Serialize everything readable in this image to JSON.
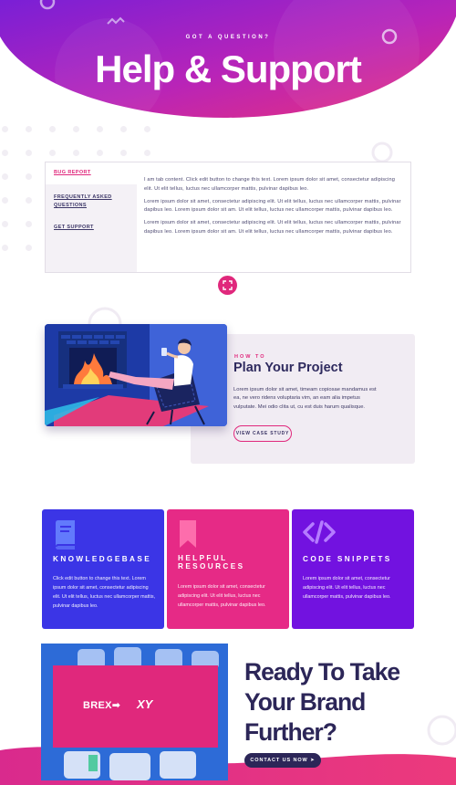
{
  "hero": {
    "eyebrow": "GOT A QUESTION?",
    "title": "Help & Support"
  },
  "tabs": {
    "items": [
      {
        "label": "BUG REPORT",
        "active": true
      },
      {
        "label": "FREQUENTLY ASKED QUESTIONS",
        "active": false
      },
      {
        "label": "GET SUPPORT",
        "active": false
      }
    ],
    "paragraphs": [
      "I am tab content. Click edit button to change this text. Lorem ipsum dolor sit amet, consectetur adipiscing elit. Ut elit tellus, luctus nec ullamcorper mattis, pulvinar dapibus leo.",
      "Lorem ipsum dolor sit amet, consectetur adipiscing elit. Ut elit tellus, luctus nec ullamcorper mattis, pulvinar dapibus leo. Lorem ipsum dolor sit am. Ut elit tellus, luctus nec ullamcorper mattis, pulvinar dapibus leo.",
      "Lorem ipsum dolor sit amet, consectetur adipiscing elit. Ut elit tellus, luctus nec ullamcorper mattis, pulvinar dapibus leo. Lorem ipsum dolor sit am. Ut elit tellus, luctus nec ullamcorper mattis, pulvinar dapibus leo."
    ]
  },
  "case_study": {
    "eyebrow": "HOW TO",
    "title": "Plan Your Project",
    "body": "Lorem ipsum dolor sit amet, timeam copiosae mandamus est ea, ne vero ridens voluptaria vim, an eam alia impetus vulputate. Mei odio clita ut, cu est duis harum qualisque.",
    "button": "VIEW CASE STUDY"
  },
  "cards": [
    {
      "title": "KNOWLEDGEBASE",
      "icon": "book-icon",
      "color": "#3b35e6",
      "body": "Click edit button to change this text. Lorem ipsum dolor sit amet, consectetur adipiscing elit. Ut elit tellus, luctus nec ullamcorper mattis, pulvinar dapibus leo."
    },
    {
      "title": "HELPFUL RESOURCES",
      "icon": "bookmark-icon",
      "color": "#e62a86",
      "body": "Lorem ipsum dolor sit amet, consectetur adipiscing elit. Ut elit tellus, luctus nec ullamcorper mattis, pulvinar dapibus leo."
    },
    {
      "title": "CODE SNIPPETS",
      "icon": "code-icon",
      "color": "#7212e0",
      "body": "Lorem ipsum dolor sit amet, consectetur adipiscing elit. Ut elit tellus, luctus nec ullamcorper mattis, pulvinar dapibus leo."
    }
  ],
  "cta": {
    "title_line1": "Ready To Take",
    "title_line2": "Your Brand",
    "title_line3": "Further?",
    "button": "CONTACT US NOW",
    "logo1": "BREX➡",
    "logo2": "XY"
  },
  "colors": {
    "primary": "#2c2658",
    "accent": "#e0287c",
    "purple": "#7212e0",
    "blue": "#3b35e6"
  }
}
